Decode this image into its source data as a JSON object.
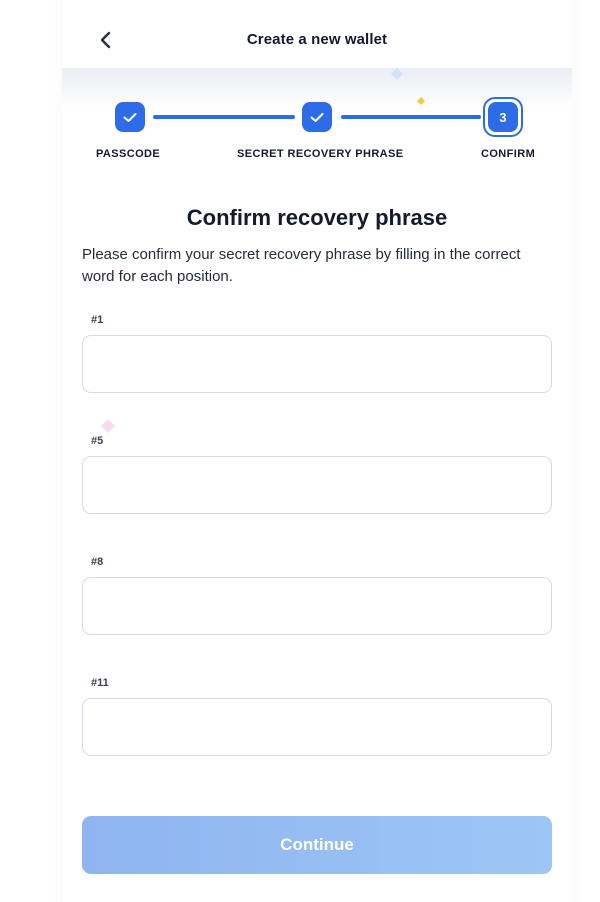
{
  "header": {
    "title": "Create a new wallet",
    "back_icon": "chevron-left-icon"
  },
  "stepper": {
    "steps": [
      {
        "label": "PASSCODE",
        "state": "complete",
        "icon": "check-icon"
      },
      {
        "label": "SECRET RECOVERY PHRASE",
        "state": "complete",
        "icon": "check-icon"
      },
      {
        "label": "CONFIRM",
        "state": "current",
        "number": "3"
      }
    ]
  },
  "main": {
    "title": "Confirm recovery phrase",
    "description": "Please confirm your secret recovery phrase by filling in the correct word for each position."
  },
  "fields": [
    {
      "label": "#1",
      "value": "",
      "placeholder": ""
    },
    {
      "label": "#5",
      "value": "",
      "placeholder": ""
    },
    {
      "label": "#8",
      "value": "",
      "placeholder": ""
    },
    {
      "label": "#11",
      "value": "",
      "placeholder": ""
    }
  ],
  "actions": {
    "continue_label": "Continue",
    "continue_enabled": false
  },
  "colors": {
    "accent": "#2e6be6",
    "button_disabled": "#95bdf2",
    "input_border": "#d7d9e6",
    "text": "#141a2e"
  }
}
